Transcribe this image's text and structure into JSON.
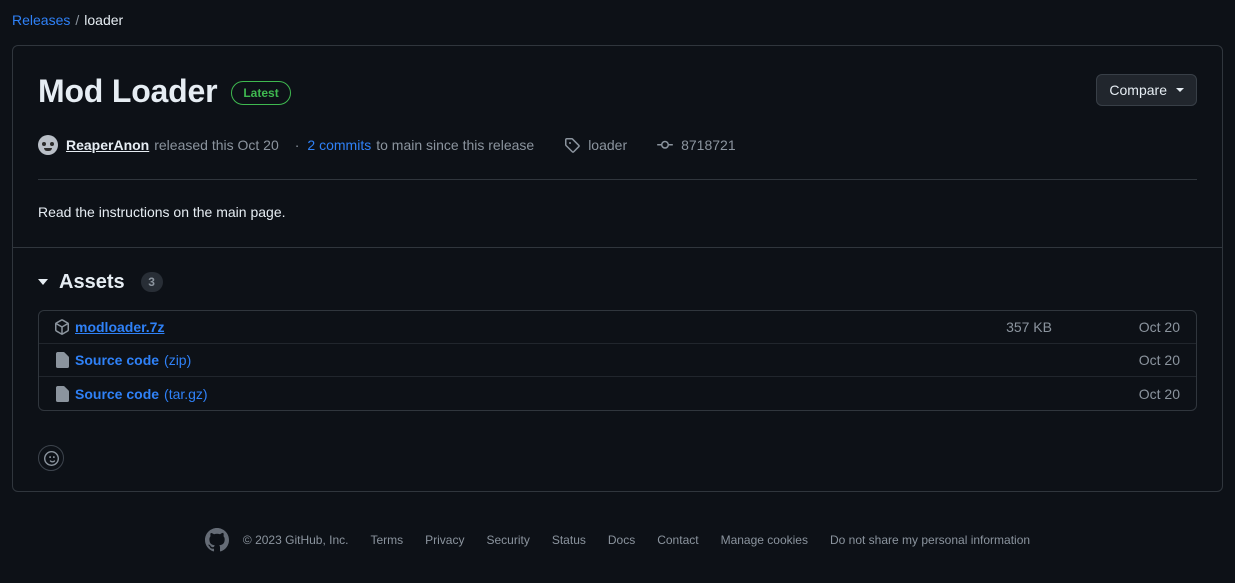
{
  "breadcrumb": {
    "root_label": "Releases",
    "separator": "/",
    "current_label": "loader"
  },
  "release": {
    "title": "Mod Loader",
    "badge_label": "Latest",
    "compare_button_label": "Compare",
    "author": "ReaperAnon",
    "released_text": "released this Oct 20",
    "meta_separator": "·",
    "commits_link_label": "2 commits",
    "commits_suffix": "to main since this release",
    "tag_label": "loader",
    "commit_hash": "8718721",
    "body_text": "Read the instructions on the main page."
  },
  "assets": {
    "title": "Assets",
    "count": "3",
    "rows": [
      {
        "name": "modloader.7z",
        "suffix": "",
        "icon": "package-icon",
        "size": "357 KB",
        "date": "Oct 20"
      },
      {
        "name": "Source code",
        "suffix": " (zip)",
        "icon": "file-zip-icon",
        "size": "",
        "date": "Oct 20"
      },
      {
        "name": "Source code",
        "suffix": " (tar.gz)",
        "icon": "file-zip-icon",
        "size": "",
        "date": "Oct 20"
      }
    ]
  },
  "footer": {
    "copyright": "© 2023 GitHub, Inc.",
    "links": [
      "Terms",
      "Privacy",
      "Security",
      "Status",
      "Docs",
      "Contact",
      "Manage cookies",
      "Do not share my personal information"
    ]
  },
  "colors": {
    "page_bg": "#0d1117",
    "border": "#30363d",
    "link": "#2f81f7",
    "green": "#3fb950",
    "text": "#e6edf3",
    "text_muted": "#8b949e"
  }
}
